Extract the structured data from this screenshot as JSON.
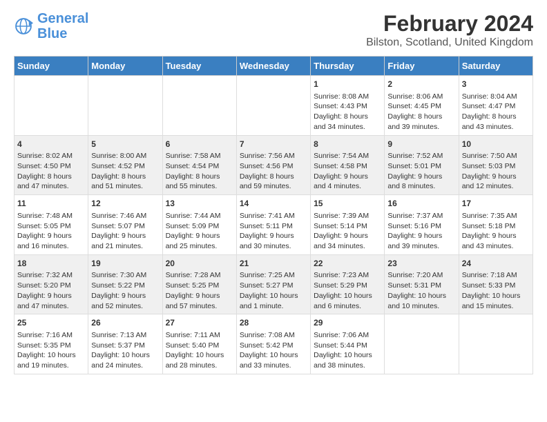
{
  "logo": {
    "line1": "General",
    "line2": "Blue"
  },
  "title": "February 2024",
  "subtitle": "Bilston, Scotland, United Kingdom",
  "days_of_week": [
    "Sunday",
    "Monday",
    "Tuesday",
    "Wednesday",
    "Thursday",
    "Friday",
    "Saturday"
  ],
  "weeks": [
    {
      "shaded": false,
      "days": [
        {
          "num": "",
          "data": ""
        },
        {
          "num": "",
          "data": ""
        },
        {
          "num": "",
          "data": ""
        },
        {
          "num": "",
          "data": ""
        },
        {
          "num": "1",
          "data": "Sunrise: 8:08 AM\nSunset: 4:43 PM\nDaylight: 8 hours and 34 minutes."
        },
        {
          "num": "2",
          "data": "Sunrise: 8:06 AM\nSunset: 4:45 PM\nDaylight: 8 hours and 39 minutes."
        },
        {
          "num": "3",
          "data": "Sunrise: 8:04 AM\nSunset: 4:47 PM\nDaylight: 8 hours and 43 minutes."
        }
      ]
    },
    {
      "shaded": true,
      "days": [
        {
          "num": "4",
          "data": "Sunrise: 8:02 AM\nSunset: 4:50 PM\nDaylight: 8 hours and 47 minutes."
        },
        {
          "num": "5",
          "data": "Sunrise: 8:00 AM\nSunset: 4:52 PM\nDaylight: 8 hours and 51 minutes."
        },
        {
          "num": "6",
          "data": "Sunrise: 7:58 AM\nSunset: 4:54 PM\nDaylight: 8 hours and 55 minutes."
        },
        {
          "num": "7",
          "data": "Sunrise: 7:56 AM\nSunset: 4:56 PM\nDaylight: 8 hours and 59 minutes."
        },
        {
          "num": "8",
          "data": "Sunrise: 7:54 AM\nSunset: 4:58 PM\nDaylight: 9 hours and 4 minutes."
        },
        {
          "num": "9",
          "data": "Sunrise: 7:52 AM\nSunset: 5:01 PM\nDaylight: 9 hours and 8 minutes."
        },
        {
          "num": "10",
          "data": "Sunrise: 7:50 AM\nSunset: 5:03 PM\nDaylight: 9 hours and 12 minutes."
        }
      ]
    },
    {
      "shaded": false,
      "days": [
        {
          "num": "11",
          "data": "Sunrise: 7:48 AM\nSunset: 5:05 PM\nDaylight: 9 hours and 16 minutes."
        },
        {
          "num": "12",
          "data": "Sunrise: 7:46 AM\nSunset: 5:07 PM\nDaylight: 9 hours and 21 minutes."
        },
        {
          "num": "13",
          "data": "Sunrise: 7:44 AM\nSunset: 5:09 PM\nDaylight: 9 hours and 25 minutes."
        },
        {
          "num": "14",
          "data": "Sunrise: 7:41 AM\nSunset: 5:11 PM\nDaylight: 9 hours and 30 minutes."
        },
        {
          "num": "15",
          "data": "Sunrise: 7:39 AM\nSunset: 5:14 PM\nDaylight: 9 hours and 34 minutes."
        },
        {
          "num": "16",
          "data": "Sunrise: 7:37 AM\nSunset: 5:16 PM\nDaylight: 9 hours and 39 minutes."
        },
        {
          "num": "17",
          "data": "Sunrise: 7:35 AM\nSunset: 5:18 PM\nDaylight: 9 hours and 43 minutes."
        }
      ]
    },
    {
      "shaded": true,
      "days": [
        {
          "num": "18",
          "data": "Sunrise: 7:32 AM\nSunset: 5:20 PM\nDaylight: 9 hours and 47 minutes."
        },
        {
          "num": "19",
          "data": "Sunrise: 7:30 AM\nSunset: 5:22 PM\nDaylight: 9 hours and 52 minutes."
        },
        {
          "num": "20",
          "data": "Sunrise: 7:28 AM\nSunset: 5:25 PM\nDaylight: 9 hours and 57 minutes."
        },
        {
          "num": "21",
          "data": "Sunrise: 7:25 AM\nSunset: 5:27 PM\nDaylight: 10 hours and 1 minute."
        },
        {
          "num": "22",
          "data": "Sunrise: 7:23 AM\nSunset: 5:29 PM\nDaylight: 10 hours and 6 minutes."
        },
        {
          "num": "23",
          "data": "Sunrise: 7:20 AM\nSunset: 5:31 PM\nDaylight: 10 hours and 10 minutes."
        },
        {
          "num": "24",
          "data": "Sunrise: 7:18 AM\nSunset: 5:33 PM\nDaylight: 10 hours and 15 minutes."
        }
      ]
    },
    {
      "shaded": false,
      "days": [
        {
          "num": "25",
          "data": "Sunrise: 7:16 AM\nSunset: 5:35 PM\nDaylight: 10 hours and 19 minutes."
        },
        {
          "num": "26",
          "data": "Sunrise: 7:13 AM\nSunset: 5:37 PM\nDaylight: 10 hours and 24 minutes."
        },
        {
          "num": "27",
          "data": "Sunrise: 7:11 AM\nSunset: 5:40 PM\nDaylight: 10 hours and 28 minutes."
        },
        {
          "num": "28",
          "data": "Sunrise: 7:08 AM\nSunset: 5:42 PM\nDaylight: 10 hours and 33 minutes."
        },
        {
          "num": "29",
          "data": "Sunrise: 7:06 AM\nSunset: 5:44 PM\nDaylight: 10 hours and 38 minutes."
        },
        {
          "num": "",
          "data": ""
        },
        {
          "num": "",
          "data": ""
        }
      ]
    }
  ]
}
